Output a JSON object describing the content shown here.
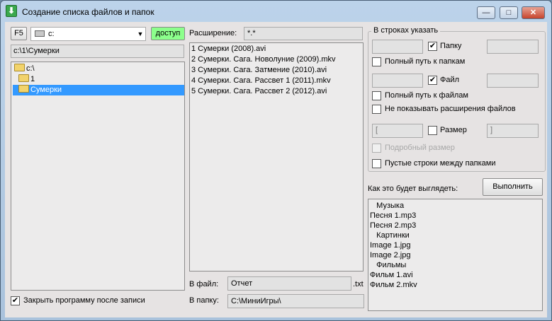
{
  "window": {
    "title": "Создание списка файлов и папок",
    "min": "—",
    "max": "□",
    "close": "✕",
    "app_icon": "⬇"
  },
  "left": {
    "f5_label": "F5",
    "drive_value": "c:",
    "dropdown_arrow": "▼",
    "access_label": "доступ",
    "path_value": "c:\\1\\Сумерки",
    "tree": [
      "c:\\",
      "1",
      "Сумерки"
    ],
    "close_after_write": "Закрыть программу после записи",
    "close_checked": "✔"
  },
  "middle": {
    "extension_label": "Расширение:",
    "extension_value": "*.*",
    "files": [
      "1 Сумерки (2008).avi",
      "2 Сумерки. Сага. Новолуние (2009).mkv",
      "3 Сумерки. Сага. Затмение (2010).avi",
      "4 Сумерки. Сага. Рассвет 1 (2011).mkv",
      "5 Сумерки. Сага. Рассвет 2 (2012).avi"
    ],
    "to_file_label": "В файл:",
    "to_file_value": "Отчет",
    "to_file_ext": ".txt",
    "to_folder_label": "В папку:",
    "to_folder_value": "C:\\МиниИгры\\"
  },
  "right": {
    "group_title": "В строках указать",
    "folder_label": "Папку",
    "folder_checked": "✔",
    "full_path_folders": "Полный путь к папкам",
    "file_label": "Файл",
    "file_checked": "✔",
    "full_path_files": "Полный путь к файлам",
    "hide_ext": "Не показывать расширения файлов",
    "size_prefix": "[",
    "size_label": "Размер",
    "size_suffix": "]",
    "detailed_size": "Подробный размер",
    "empty_lines": "Пустые строки между папками",
    "preview_label": "Как это будет выглядеть:",
    "run_button": "Выполнить",
    "preview": [
      "   Музыка",
      "Песня 1.mp3",
      "Песня 2.mp3",
      "   Картинки",
      "Image 1.jpg",
      "Image 2.jpg",
      "   Фильмы",
      "Фильм 1.avi",
      "Фильм 2.mkv"
    ]
  },
  "colors": {
    "selection": "#3399ff",
    "access_green": "#8cff8c"
  }
}
